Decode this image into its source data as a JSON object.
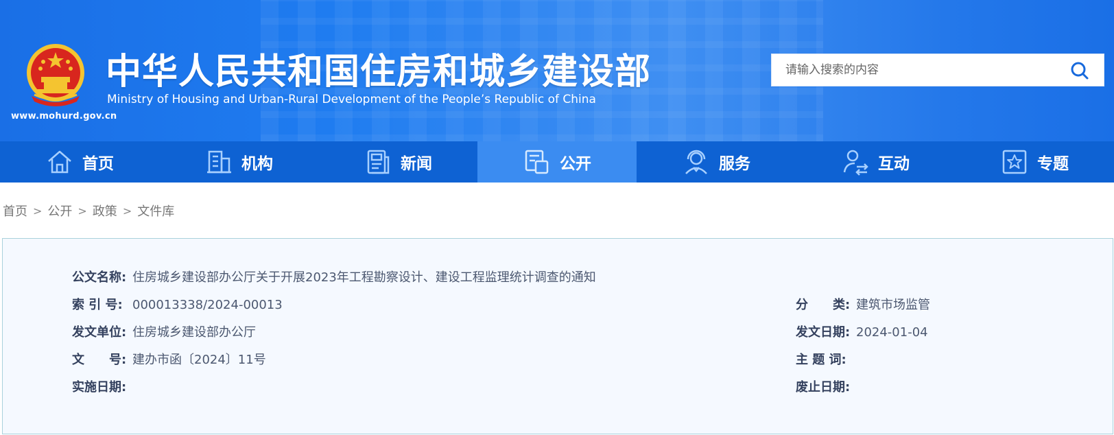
{
  "header": {
    "title_cn": "中华人民共和国住房和城乡建设部",
    "title_en": "Ministry of Housing and Urban-Rural Development of the People’s Republic of China",
    "site_url": "www.mohurd.gov.cn",
    "search_placeholder": "请输入搜索的内容",
    "icons": {
      "emblem": "national-emblem-icon",
      "search": "search-icon"
    }
  },
  "nav": {
    "items": [
      {
        "label": "首页",
        "icon": "home-icon"
      },
      {
        "label": "机构",
        "icon": "building-icon"
      },
      {
        "label": "新闻",
        "icon": "newspaper-icon"
      },
      {
        "label": "公开",
        "icon": "document-icon",
        "active": true
      },
      {
        "label": "服务",
        "icon": "service-agent-icon"
      },
      {
        "label": "互动",
        "icon": "interaction-icon"
      },
      {
        "label": "专题",
        "icon": "star-topic-icon"
      }
    ]
  },
  "breadcrumb": {
    "items": [
      "首页",
      "公开",
      "政策",
      "文件库"
    ],
    "separator": ">"
  },
  "document": {
    "title_label": "公文名称:",
    "title_value": "住房城乡建设部办公厅关于开展2023年工程勘察设计、建设工程监理统计调查的通知",
    "index_label": "索 引 号:",
    "index_value": "000013338/2024-00013",
    "category_label": "分　　类:",
    "category_value": "建筑市场监管",
    "issuer_label": "发文单位:",
    "issuer_value": "住房城乡建设部办公厅",
    "date_label": "发文日期:",
    "date_value": "2024-01-04",
    "number_label": "文　　号:",
    "number_value": "建办市函〔2024〕11号",
    "keywords_label": "主 题 词:",
    "keywords_value": "",
    "effective_label": "实施日期:",
    "effective_value": "",
    "expiry_label": "废止日期:",
    "expiry_value": ""
  },
  "colors": {
    "header_blue": "#1f7cf0",
    "nav_blue": "#0e62d3",
    "nav_active": "#3b8cf1",
    "emblem_red": "#d8261e",
    "emblem_gold": "#f4c430",
    "info_bg": "#f5f9ff",
    "info_border": "#a9d2dc"
  }
}
